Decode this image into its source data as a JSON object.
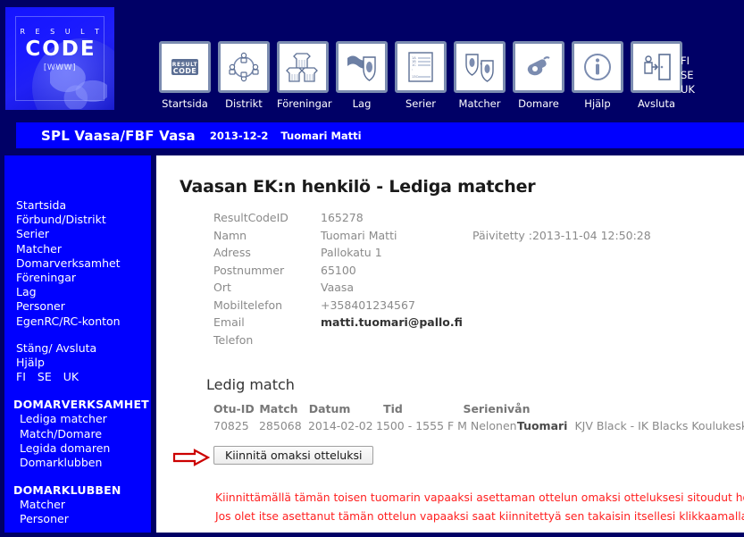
{
  "logo": {
    "result_text": "R E S U L T",
    "code_text": "CODE",
    "www_text": "[WWW]"
  },
  "nav": {
    "items": [
      {
        "label": "Startsida",
        "icon": "resultcode-logo-icon"
      },
      {
        "label": "Distrikt",
        "icon": "network-people-icon"
      },
      {
        "label": "Föreningar",
        "icon": "jerseys-icon"
      },
      {
        "label": "Lag",
        "icon": "flag-shield-icon"
      },
      {
        "label": "Serier",
        "icon": "standings-list-icon"
      },
      {
        "label": "Matcher",
        "icon": "shields-versus-icon"
      },
      {
        "label": "Domare",
        "icon": "whistle-icon"
      },
      {
        "label": "Hjälp",
        "icon": "info-circle-icon"
      },
      {
        "label": "Avsluta",
        "icon": "exit-door-icon"
      }
    ],
    "languages": [
      "FI",
      "SE",
      "UK"
    ]
  },
  "titlebar": {
    "organization": "SPL Vaasa/FBF Vasa",
    "date": "2013-12-2",
    "user": "Tuomari Matti"
  },
  "sidebar": {
    "main_links": [
      "Startsida",
      "Förbund/Distrikt",
      "Serier",
      "Matcher",
      "Domarverksamhet",
      "Föreningar",
      "Lag",
      "Personer",
      "EgenRC/RC-konton"
    ],
    "secondary_links": [
      "Stäng/ Avsluta",
      "Hjälp"
    ],
    "languages": [
      "FI",
      "SE",
      "UK"
    ],
    "sections": [
      {
        "heading": "DOMARVERKSAMHET",
        "items": [
          "Lediga matcher",
          "Match/Domare",
          "Legida domaren",
          "Domarklubben"
        ]
      },
      {
        "heading": "DOMARKLUBBEN",
        "items": [
          "Matcher",
          "Personer"
        ]
      }
    ]
  },
  "content": {
    "page_title": "Vaasan EK:n henkilö - Lediga matcher",
    "fields": [
      {
        "label": "ResultCodeID",
        "value": "165278",
        "extra": "",
        "strong": false
      },
      {
        "label": "Namn",
        "value": "Tuomari Matti",
        "extra": "Päivitetty :2013-11-04 12:50:28",
        "strong": false
      },
      {
        "label": "Adress",
        "value": "Pallokatu 1",
        "extra": "",
        "strong": false
      },
      {
        "label": "Postnummer",
        "value": "65100",
        "extra": "",
        "strong": false
      },
      {
        "label": "Ort",
        "value": "Vaasa",
        "extra": "",
        "strong": false
      },
      {
        "label": "Mobiltelefon",
        "value": "+358401234567",
        "extra": "",
        "strong": false
      },
      {
        "label": "Email",
        "value": "matti.tuomari@pallo.fi",
        "extra": "",
        "strong": true
      },
      {
        "label": "Telefon",
        "value": "",
        "extra": "",
        "strong": false
      }
    ],
    "section_title": "Ledig match",
    "table": {
      "headers": [
        "Otu-ID",
        "Match",
        "Datum",
        "Tid",
        "Serienivån"
      ],
      "rows": [
        {
          "otu_id": "70825",
          "match": "285068",
          "datum": "2014-02-02",
          "tid": "1500 - 1555",
          "serieniva": "F M Nelonen",
          "role": "Tuomari",
          "teams_venue": "KJV Black - IK Blacks Koulukeskus, Kar"
        }
      ]
    },
    "attach_button": "Kiinnitä omaksi otteluksi",
    "warnings": [
      "Kiinnittämällä tämän toisen tuomarin vapaaksi asettaman ottelun omaksi otteluksesi sitoudut hoitamaa",
      "Jos olet itse asettanut tämän ottelun vapaaksi saat kiinnitettyä sen takaisin itsellesi klikkaamalla!"
    ]
  },
  "colors": {
    "navy": "#000066",
    "blue": "#0000ff",
    "warning_red": "#ff2020",
    "icon_blue": "#7b8cb0"
  }
}
